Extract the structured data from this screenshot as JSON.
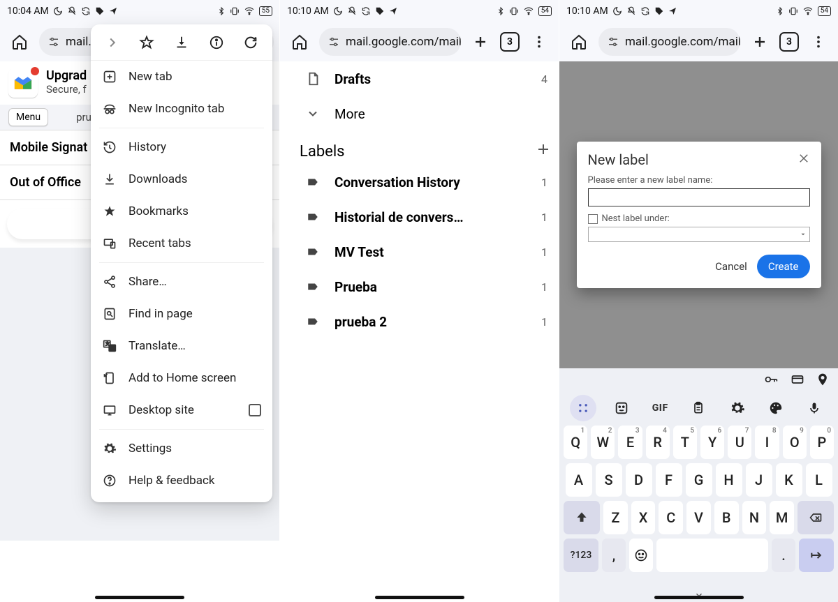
{
  "screens": {
    "s1": {
      "status": {
        "time": "10:04 AM",
        "battery": "55"
      },
      "url": "mail.g",
      "content": {
        "upgrade_line1": "Upgrad",
        "upgrade_line2": "Secure, f",
        "menu_chip": "Menu",
        "pre_text": "pru",
        "row1": "Mobile Signat",
        "row2": "Out of Office ",
        "home_btn": "H"
      },
      "menu": {
        "items": [
          {
            "id": "new-tab",
            "label": "New tab"
          },
          {
            "id": "incognito-tab",
            "label": "New Incognito tab"
          },
          {
            "id": "history",
            "label": "History"
          },
          {
            "id": "downloads",
            "label": "Downloads"
          },
          {
            "id": "bookmarks",
            "label": "Bookmarks"
          },
          {
            "id": "recent-tabs",
            "label": "Recent tabs"
          },
          {
            "id": "share",
            "label": "Share…"
          },
          {
            "id": "find",
            "label": "Find in page"
          },
          {
            "id": "translate",
            "label": "Translate…"
          },
          {
            "id": "add-home",
            "label": "Add to Home screen"
          },
          {
            "id": "desktop",
            "label": "Desktop site"
          },
          {
            "id": "settings",
            "label": "Settings"
          },
          {
            "id": "help",
            "label": "Help & feedback"
          }
        ]
      }
    },
    "s2": {
      "status": {
        "time": "10:10 AM",
        "battery": "54"
      },
      "url": "mail.google.com/mail",
      "tab_count": "3",
      "folders": {
        "drafts": {
          "label": "Drafts",
          "count": "4"
        },
        "more": {
          "label": "More"
        }
      },
      "labels_header": "Labels",
      "labels": [
        {
          "label": "Conversation History",
          "count": "1"
        },
        {
          "label": "Historial de convers…",
          "count": "1"
        },
        {
          "label": "MV Test",
          "count": "1"
        },
        {
          "label": "Prueba",
          "count": "1"
        },
        {
          "label": "prueba 2",
          "count": "1"
        }
      ]
    },
    "s3": {
      "status": {
        "time": "10:10 AM",
        "battery": "54"
      },
      "url": "mail.google.com/mail",
      "tab_count": "3",
      "dialog": {
        "title": "New label",
        "hint": "Please enter a new label name:",
        "nest_label": "Nest label under:",
        "cancel": "Cancel",
        "create": "Create"
      },
      "keyboard": {
        "row1": [
          "Q",
          "W",
          "E",
          "R",
          "T",
          "Y",
          "U",
          "I",
          "O",
          "P"
        ],
        "row1sup": [
          "1",
          "2",
          "3",
          "4",
          "5",
          "6",
          "7",
          "8",
          "9",
          "0"
        ],
        "row2": [
          "A",
          "S",
          "D",
          "F",
          "G",
          "H",
          "J",
          "K",
          "L"
        ],
        "row3": [
          "Z",
          "X",
          "C",
          "V",
          "B",
          "N",
          "M"
        ],
        "sym": "?123",
        "comma": ",",
        "period": ".",
        "gif": "GIF"
      }
    }
  }
}
